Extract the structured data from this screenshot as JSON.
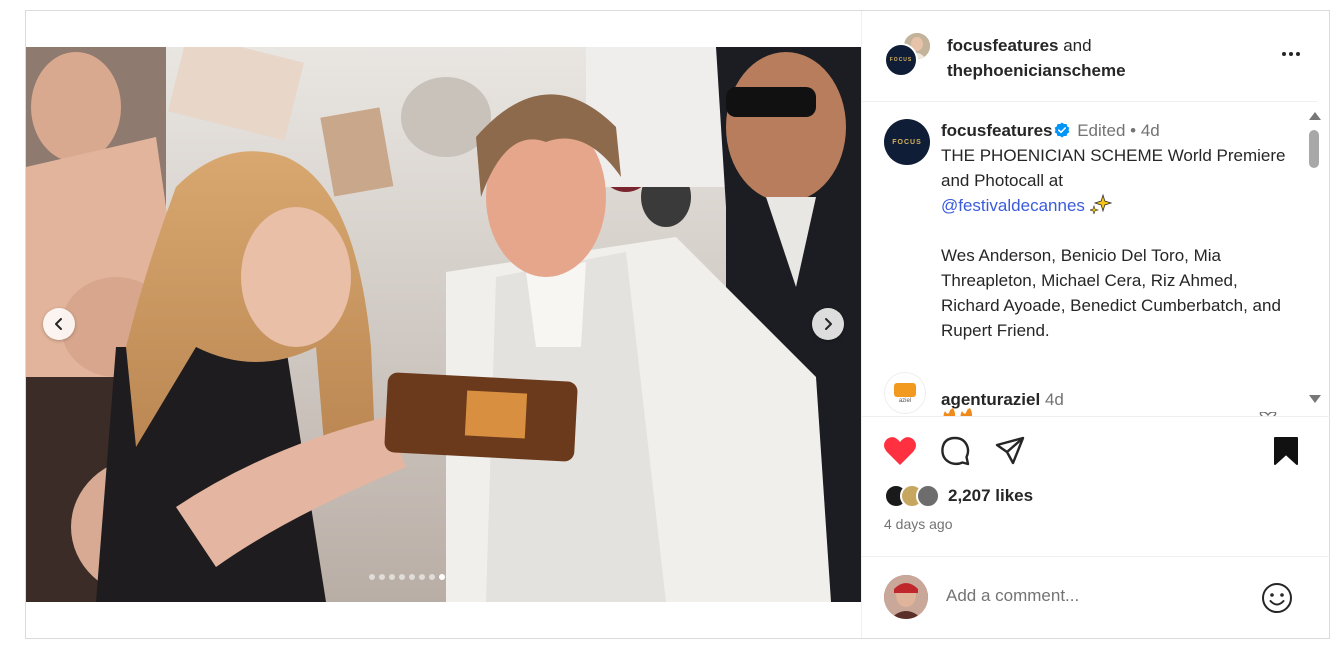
{
  "header": {
    "user1": "focusfeatures",
    "and_text": "and",
    "user2": "thephoenicianscheme",
    "avatar_logo_text": "FOCUS"
  },
  "caption": {
    "username": "focusfeatures",
    "edited": "Edited",
    "separator": "•",
    "age": "4d",
    "line1": "THE PHOENICIAN SCHEME World Premiere and Photocall at",
    "mention": "@festivaldecannes",
    "names": "Wes Anderson, Benicio Del Toro, Mia Threapleton, Michael Cera, Riz Ahmed, Richard Ayoade, Benedict Cumberbatch, and Rupert Friend."
  },
  "comment2": {
    "username": "agenturaziel",
    "age": "4d",
    "avatar_text": "aziel"
  },
  "media": {
    "slide_count": 8,
    "active_slide": 8
  },
  "likes": {
    "text": "2,207 likes"
  },
  "timestamp": "4 days ago",
  "add_comment": {
    "placeholder": "Add a comment..."
  },
  "icons": {
    "like": "heart-icon",
    "comment": "comment-icon",
    "share": "share-icon",
    "save": "bookmark-icon",
    "emoji": "emoji-icon",
    "more": "more-icon",
    "prev": "chevron-left-icon",
    "next": "chevron-right-icon",
    "verified": "verified-badge-icon"
  },
  "colors": {
    "like_red": "#ff3040",
    "mention_blue": "#3b5bdb",
    "verified_blue": "#0095f6"
  }
}
